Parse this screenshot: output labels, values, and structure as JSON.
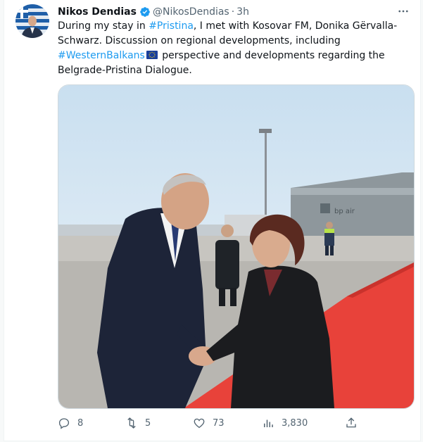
{
  "author": {
    "name": "Nikos Dendias",
    "handle": "@NikosDendias",
    "separator": "·",
    "time": "3h",
    "verified": true
  },
  "tweet_text": {
    "part1": "During my stay in ",
    "hashtag1": "#Pristina",
    "part2": ", I met with Kosovar FM, Donika Gërvalla-Schwarz. Discussion on regional developments, including ",
    "hashtag2": "#WesternBalkans",
    "emoji": "EU flag",
    "part3": " perspective and developments regarding the Belgrade-Pristina Dialogue."
  },
  "media": {
    "building_sign": "bp air"
  },
  "actions": {
    "replies": "8",
    "retweets": "5",
    "likes": "73",
    "views": "3,830"
  },
  "icons": {
    "verified": "verified-badge-icon",
    "more": "more-icon",
    "reply": "reply-icon",
    "retweet": "retweet-icon",
    "like": "like-icon",
    "views": "views-icon",
    "share": "share-icon"
  },
  "colors": {
    "link": "#1d9bf0",
    "text": "#0f1419",
    "muted": "#536471",
    "carpet": "#e8423a"
  }
}
